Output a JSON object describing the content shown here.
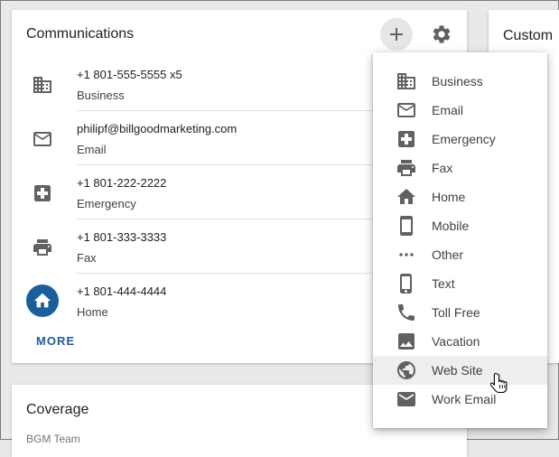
{
  "communications": {
    "title": "Communications",
    "more_label": "MORE",
    "items": [
      {
        "value": "+1 801-555-5555 x5",
        "type": "Business",
        "icon": "business-icon"
      },
      {
        "value": "philipf@billgoodmarketing.com",
        "type": "Email",
        "icon": "email-icon"
      },
      {
        "value": "+1 801-222-2222",
        "type": "Emergency",
        "icon": "emergency-icon"
      },
      {
        "value": "+1 801-333-3333",
        "type": "Fax",
        "icon": "fax-icon"
      },
      {
        "value": "+1 801-444-4444",
        "type": "Home",
        "icon": "home-icon"
      }
    ]
  },
  "custom_card": {
    "title": "Custom"
  },
  "coverage": {
    "title": "Coverage",
    "subtitle": "BGM Team"
  },
  "add_menu": {
    "highlighted": "Web Site",
    "items": [
      {
        "label": "Business",
        "icon": "business-icon"
      },
      {
        "label": "Email",
        "icon": "email-outline-icon"
      },
      {
        "label": "Emergency",
        "icon": "emergency-icon"
      },
      {
        "label": "Fax",
        "icon": "fax-icon"
      },
      {
        "label": "Home",
        "icon": "home-icon"
      },
      {
        "label": "Mobile",
        "icon": "mobile-icon"
      },
      {
        "label": "Other",
        "icon": "more-horizontal-icon"
      },
      {
        "label": "Text",
        "icon": "text-phone-icon"
      },
      {
        "label": "Toll Free",
        "icon": "phone-icon"
      },
      {
        "label": "Vacation",
        "icon": "image-icon"
      },
      {
        "label": "Web Site",
        "icon": "globe-icon"
      },
      {
        "label": "Work Email",
        "icon": "email-filled-icon"
      }
    ]
  },
  "colors": {
    "accent": "#1b5e9c",
    "icon": "#616161"
  }
}
